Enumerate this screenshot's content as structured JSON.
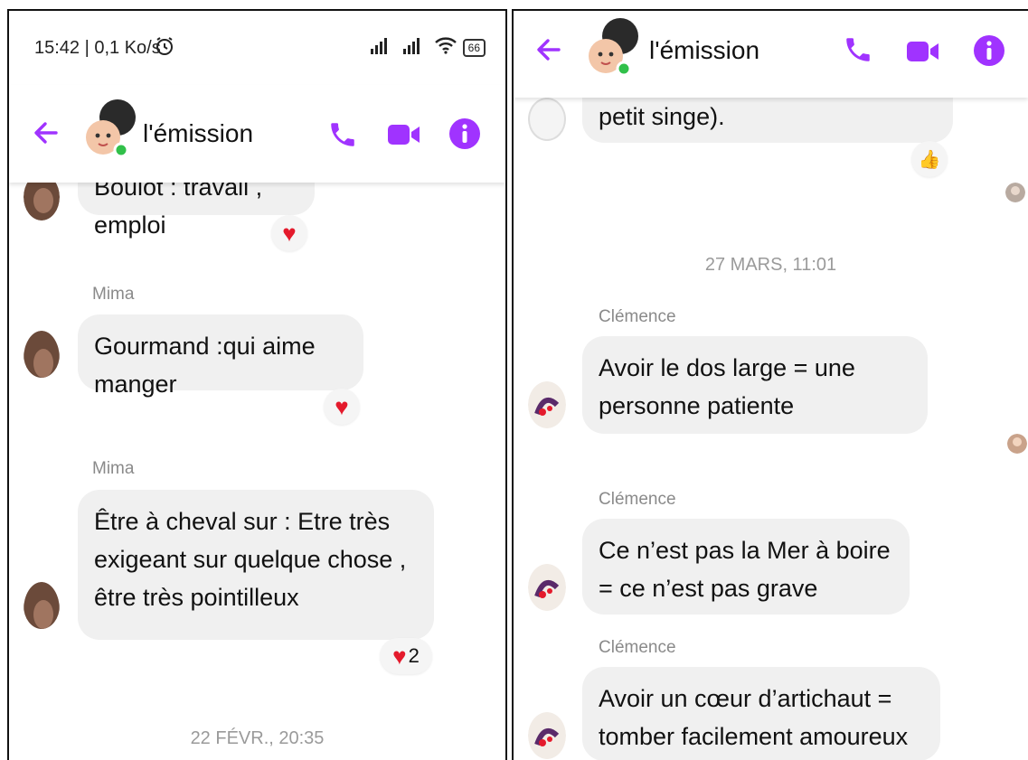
{
  "left": {
    "status": {
      "time": "15:42 | 0,1 Ko/s",
      "battery": "66",
      "alarm_icon": "alarm-icon",
      "signal_icon": "signal-icon",
      "wifi_icon": "wifi-icon"
    },
    "header": {
      "title": "l'émission",
      "back_icon": "back-arrow-icon",
      "call_icon": "phone-icon",
      "video_icon": "video-icon",
      "info_icon": "info-icon"
    },
    "messages": [
      {
        "text": "Boulot : travail , emploi",
        "reaction": "♥",
        "reaction_count": ""
      },
      {
        "sender": "Mima",
        "text": "Gourmand :qui aime manger",
        "reaction": "♥",
        "reaction_count": ""
      },
      {
        "sender": "Mima",
        "text": "Être à cheval sur : Etre très exigeant sur quelque chose , être très pointilleux",
        "reaction": "♥",
        "reaction_count": "2"
      }
    ],
    "date_separator": "22 FÉVR., 20:35"
  },
  "right": {
    "header": {
      "title": "l'émission",
      "back_icon": "back-arrow-icon",
      "call_icon": "phone-icon",
      "video_icon": "video-icon",
      "info_icon": "info-icon"
    },
    "top_message": {
      "text": "petit singe).",
      "reaction": "👍"
    },
    "date_separator": "27 MARS, 11:01",
    "messages": [
      {
        "sender": "Clémence",
        "text": "Avoir le dos large = une personne patiente"
      },
      {
        "sender": "Clémence",
        "text": "Ce n’est pas la Mer à boire  = ce n’est pas grave"
      },
      {
        "sender": "Clémence",
        "text": "Avoir un cœur d’artichaut = tomber facilement amoureux"
      }
    ]
  },
  "colors": {
    "accent": "#a033ff",
    "bubble": "#f0f0f0",
    "heart": "#e41a2c",
    "online": "#31c04a"
  }
}
